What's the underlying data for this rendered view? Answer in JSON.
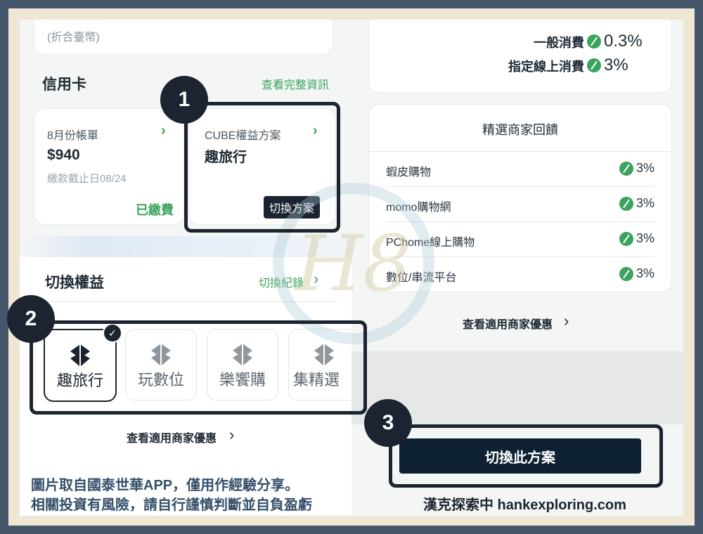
{
  "left": {
    "top_card": {
      "partial_text": "(折合臺幣)"
    },
    "credit_section": {
      "title": "信用卡",
      "link": "查看完整資訊"
    },
    "bill_card": {
      "month": "8月份帳單",
      "amount": "$940",
      "due": "繳款截止日08/24",
      "status": "已繳費"
    },
    "plan_card": {
      "label": "CUBE權益方案",
      "plan": "趣旅行",
      "switch_button": "切換方案"
    },
    "switch_section": {
      "title": "切換權益",
      "link": "切換紀錄"
    },
    "tiles": [
      {
        "label": "趣旅行",
        "selected": true
      },
      {
        "label": "玩數位",
        "selected": false
      },
      {
        "label": "樂饗購",
        "selected": false
      },
      {
        "label": "集精選",
        "selected": false
      }
    ],
    "merchant_link": "查看適用商家優惠"
  },
  "right": {
    "rates": [
      {
        "label": "一般消費",
        "value": "0.3%"
      },
      {
        "label": "指定線上消費",
        "value": "3%"
      }
    ],
    "merchants_title": "精選商家回饋",
    "merchants": [
      {
        "name": "蝦皮購物",
        "rate": "3%"
      },
      {
        "name": "momo購物網",
        "rate": "3%"
      },
      {
        "name": "PChome線上購物",
        "rate": "3%"
      },
      {
        "name": "數位/串流平台",
        "rate": "3%"
      }
    ],
    "merchant_link": "查看適用商家優惠",
    "switch_plan_button": "切換此方案"
  },
  "markers": [
    "1",
    "2",
    "3"
  ],
  "caption": {
    "line1": "圖片取自國泰世華APP，僅用作經驗分享。",
    "line2": "相關投資有風險，請自行謹慎判斷並自負盈虧",
    "brand": "漢克探索中 hankexploring.com"
  },
  "watermark_text": "H8",
  "colors": {
    "accent": "#3aa35e",
    "dark": "#1b2430",
    "frame": "#45566a"
  }
}
